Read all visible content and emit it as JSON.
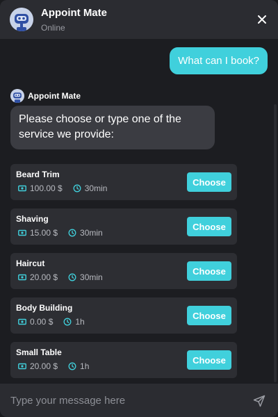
{
  "header": {
    "title": "Appoint Mate",
    "status": "Online"
  },
  "conversation": {
    "user_message": "What can I book?",
    "bot_name": "Appoint Mate",
    "bot_message": "Please choose or type one of the service we provide:"
  },
  "services": [
    {
      "name": "Beard Trim",
      "price": "100.00 $",
      "duration": "30min",
      "action": "Choose"
    },
    {
      "name": "Shaving",
      "price": "15.00 $",
      "duration": "30min",
      "action": "Choose"
    },
    {
      "name": "Haircut",
      "price": "20.00 $",
      "duration": "30min",
      "action": "Choose"
    },
    {
      "name": "Body Building",
      "price": "0.00 $",
      "duration": "1h",
      "action": "Choose"
    },
    {
      "name": "Small Table",
      "price": "20.00 $",
      "duration": "1h",
      "action": "Choose"
    }
  ],
  "composer": {
    "placeholder": "Type your message here"
  },
  "icons": {
    "bot_avatar": "robot-avatar-icon",
    "close": "close-icon",
    "price": "money-icon",
    "duration": "clock-icon",
    "send": "send-icon"
  },
  "colors": {
    "accent": "#40d0dc",
    "background": "#1c1d21",
    "header": "#2b2c31",
    "card": "#2d2e33",
    "bot_bubble": "#3b3c42"
  }
}
